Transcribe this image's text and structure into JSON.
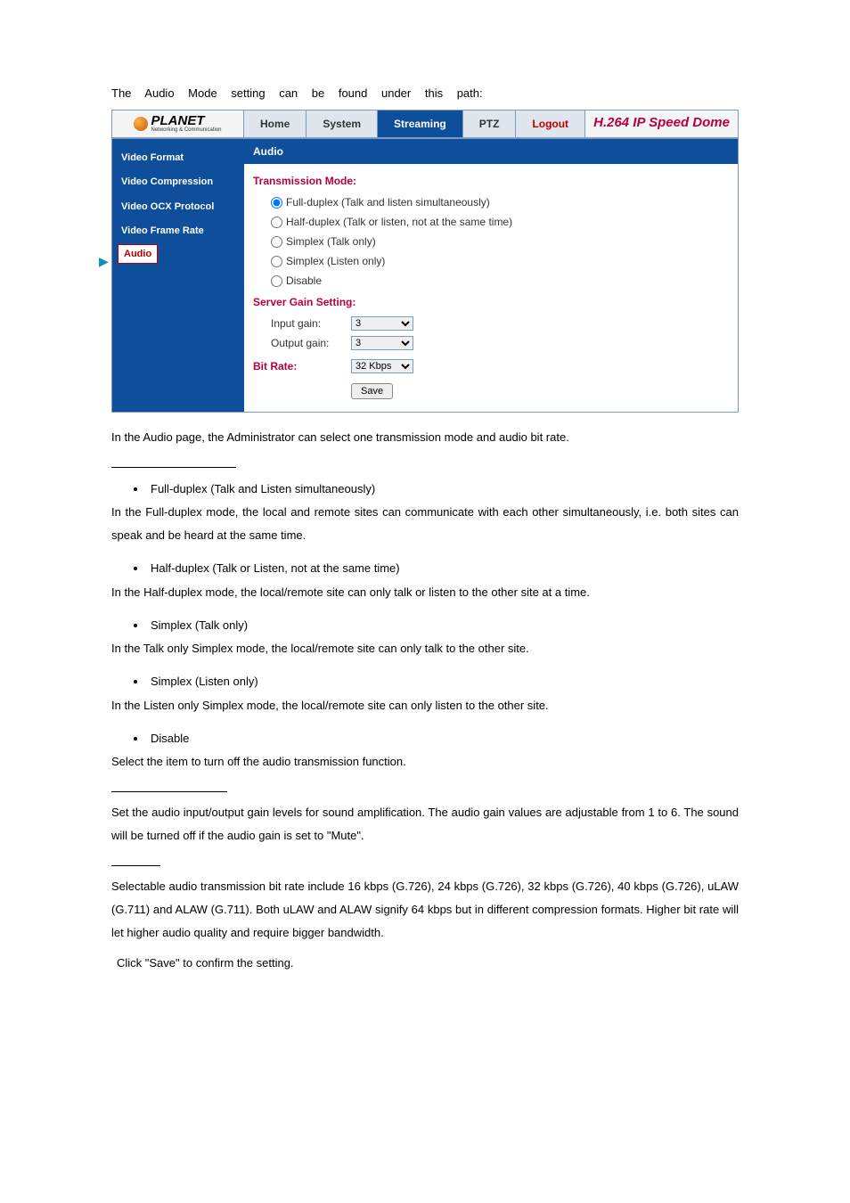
{
  "intro": "The Audio Mode setting can be found under this path:",
  "screenshot": {
    "logo_name": "PLANET",
    "logo_sub": "Networking & Communication",
    "nav": {
      "home": "Home",
      "system": "System",
      "streaming": "Streaming",
      "ptz": "PTZ",
      "logout": "Logout"
    },
    "brand": "H.264 IP Speed Dome",
    "sidebar": {
      "video_format": "Video Format",
      "video_compression": "Video Compression",
      "video_ocx": "Video OCX Protocol",
      "video_frame_rate": "Video Frame Rate",
      "audio": "Audio"
    },
    "content": {
      "header": "Audio",
      "transmission_mode": "Transmission Mode:",
      "opt_full": "Full-duplex (Talk and listen simultaneously)",
      "opt_half": "Half-duplex (Talk or listen, not at the same time)",
      "opt_simplex_talk": "Simplex (Talk only)",
      "opt_simplex_listen": "Simplex (Listen only)",
      "opt_disable": "Disable",
      "server_gain": "Server Gain Setting:",
      "input_gain_label": "Input gain:",
      "input_gain_value": "3",
      "output_gain_label": "Output gain:",
      "output_gain_value": "3",
      "bitrate_label": "Bit Rate:",
      "bitrate_value": "32 Kbps",
      "save": "Save"
    }
  },
  "doc": {
    "after_img": "In the Audio page, the Administrator can select one transmission mode and audio bit rate.",
    "b1_title": "Full-duplex (Talk and Listen simultaneously)",
    "b1_text": "In the Full-duplex mode, the local and remote sites can communicate with each other simultaneously, i.e. both sites can speak and be heard at the same time.",
    "b2_title": "Half-duplex (Talk or Listen, not at the same time)",
    "b2_text": "In the Half-duplex mode, the local/remote site can only talk or listen to the other site at a time.",
    "b3_title": "Simplex (Talk only)",
    "b3_text": "In the Talk only Simplex mode, the local/remote site can only talk to the other site.",
    "b4_title": "Simplex (Listen only)",
    "b4_text": "In the Listen only Simplex mode, the local/remote site can only listen to the other site.",
    "b5_title": "Disable",
    "b5_text": "Select the item to turn off the audio transmission function.",
    "gain_text": "Set the audio input/output gain levels for sound amplification. The audio gain values are adjustable from 1 to 6. The sound will be turned off if the audio gain is set to \"Mute\".",
    "bitrate_text": "Selectable audio transmission bit rate include 16 kbps (G.726), 24 kbps (G.726), 32 kbps (G.726), 40 kbps (G.726), uLAW (G.711) and ALAW (G.711). Both uLAW and ALAW signify 64 kbps but in different compression formats. Higher bit rate will let higher audio quality and require bigger bandwidth.",
    "save_note": "Click \"Save\" to confirm the setting."
  }
}
